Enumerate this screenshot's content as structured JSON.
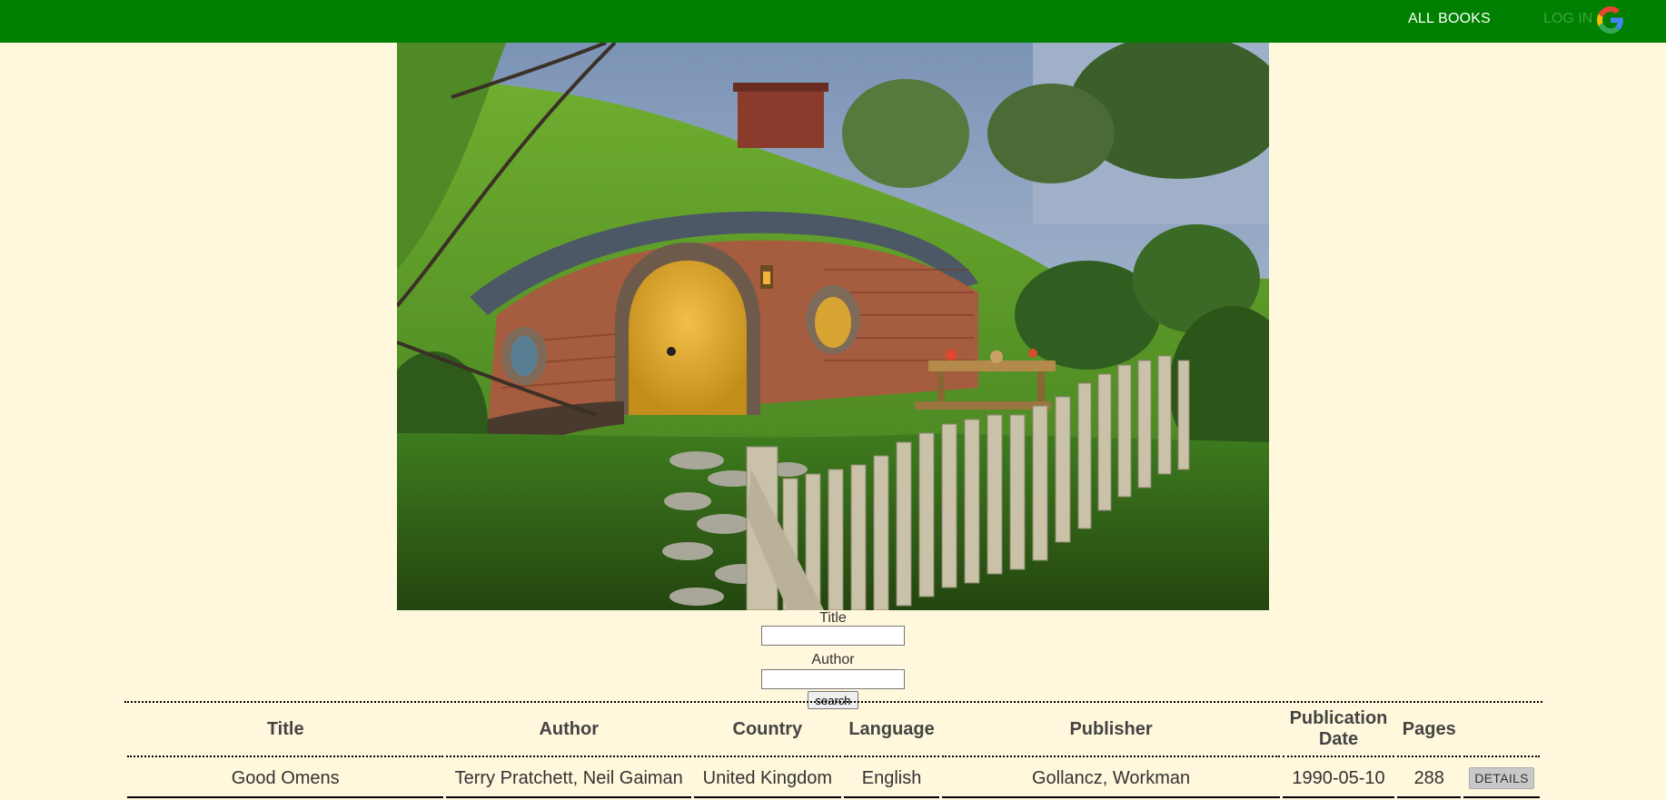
{
  "nav": {
    "all_books": "ALL BOOKS",
    "login": "LOG IN",
    "google_icon": "google-icon"
  },
  "hero": {
    "image": "hobbit-hole-photo"
  },
  "search": {
    "title_label": "Title",
    "title_value": "",
    "author_label": "Author",
    "author_value": "",
    "button_label": "search"
  },
  "table": {
    "headers": [
      "Title",
      "Author",
      "Country",
      "Language",
      "Publisher",
      "Publication Date",
      "Pages"
    ],
    "rows": [
      {
        "title": "Good Omens",
        "author": "Terry Pratchett, Neil Gaiman",
        "country": "United Kingdom",
        "language": "English",
        "publisher": "Gollancz, Workman",
        "publication_date": "1990-05-10",
        "pages": "288",
        "action": "DETAILS"
      }
    ]
  },
  "colors": {
    "topbar": "#008000",
    "background": "#fff8dc"
  }
}
